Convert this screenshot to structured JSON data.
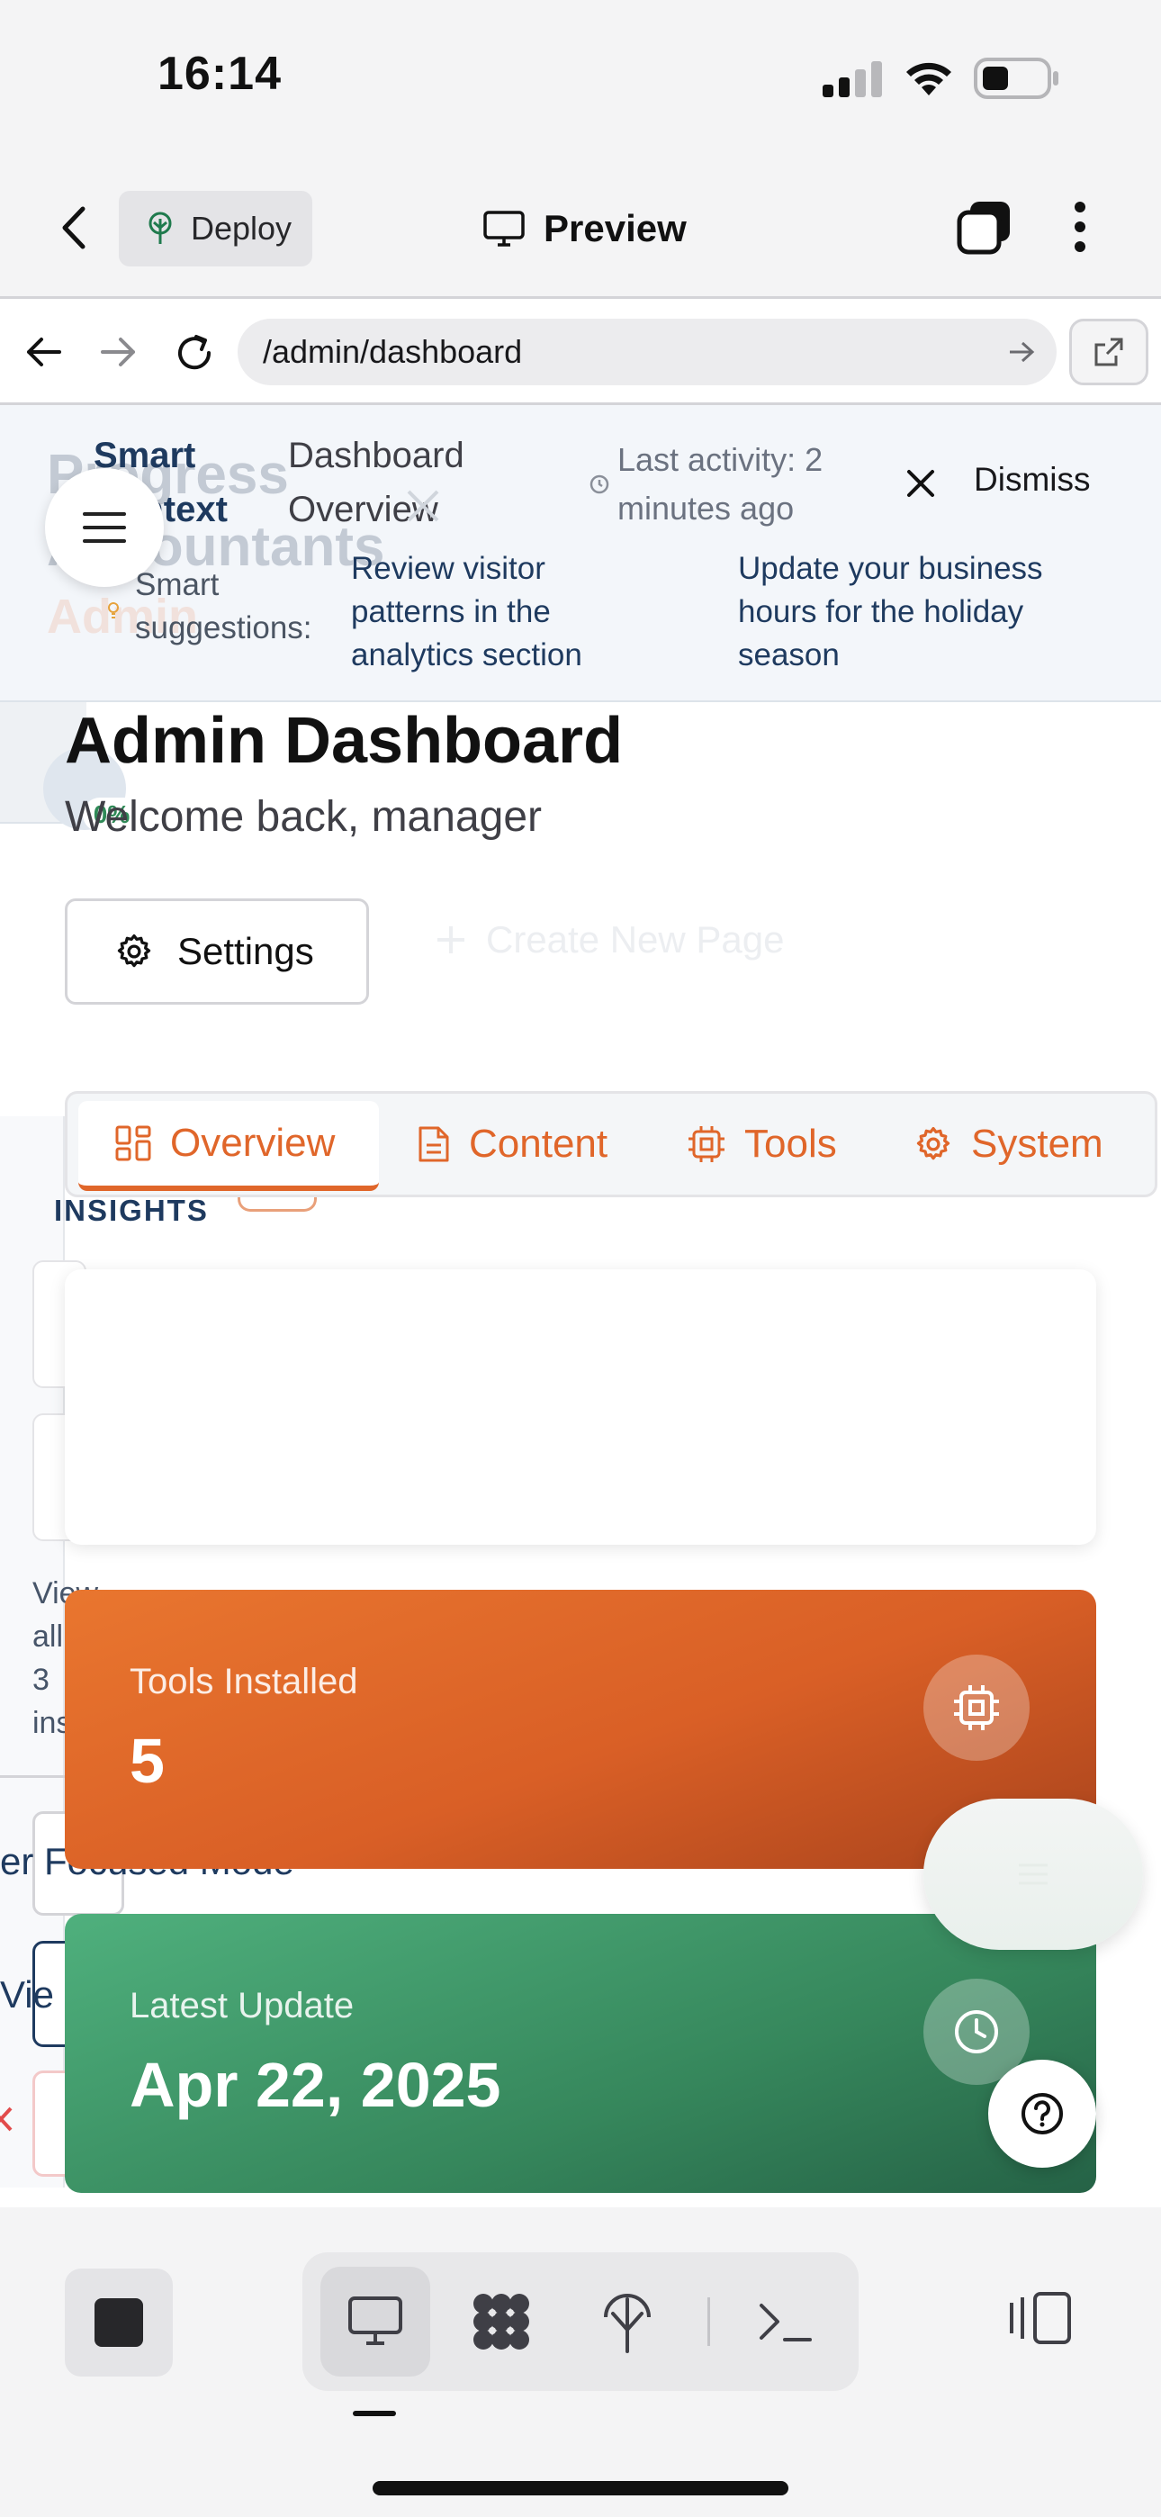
{
  "status_bar": {
    "time": "16:14"
  },
  "app_header": {
    "deploy_label": "Deploy",
    "preview_label": "Preview"
  },
  "browser": {
    "url": "/admin/dashboard"
  },
  "context_banner": {
    "smart_context_line1": "Smart",
    "smart_context_line2": "Context",
    "page_name_line1": "Dashboard",
    "page_name_line2": "Overview",
    "last_activity_line1": "Last activity: 2",
    "last_activity_line2": "minutes ago",
    "dismiss_label": "Dismiss",
    "suggestions_label_line1": "Smart",
    "suggestions_label_line2": "suggestions:",
    "suggestion_1": [
      "Review visitor",
      "patterns in the",
      "analytics section"
    ],
    "suggestion_2": [
      "Update your business",
      "hours for the holiday",
      "season"
    ],
    "ghost_line1": "Progress",
    "ghost_line2": "Accountants",
    "ghost_line3": "Admin"
  },
  "dashboard": {
    "title": "Admin Dashboard",
    "subtitle": "Welcome back, manager",
    "settings_label": "Settings",
    "create_page_label": "Create New Page",
    "progress_badge": "0%"
  },
  "tabs": [
    {
      "label": "Overview",
      "icon": "layout-grid-icon"
    },
    {
      "label": "Content",
      "icon": "file-text-icon"
    },
    {
      "label": "Tools",
      "icon": "cpu-icon"
    },
    {
      "label": "System",
      "icon": "gear-icon"
    }
  ],
  "background_panel": {
    "insights_label": "INSIGHTS",
    "view_all": [
      "View",
      "all",
      "3",
      "ins"
    ],
    "focused_mode": "er Focused Mode",
    "view_fragment": "Vie"
  },
  "stats": [
    {
      "label": "Tools Installed",
      "value": "5",
      "icon": "cpu-icon",
      "color": "#e06a2b"
    },
    {
      "label": "Latest Update",
      "value": "Apr 22, 2025",
      "icon": "clock-icon",
      "color": "#3f9a6a"
    }
  ],
  "help": {
    "icon": "help-circle-icon"
  }
}
